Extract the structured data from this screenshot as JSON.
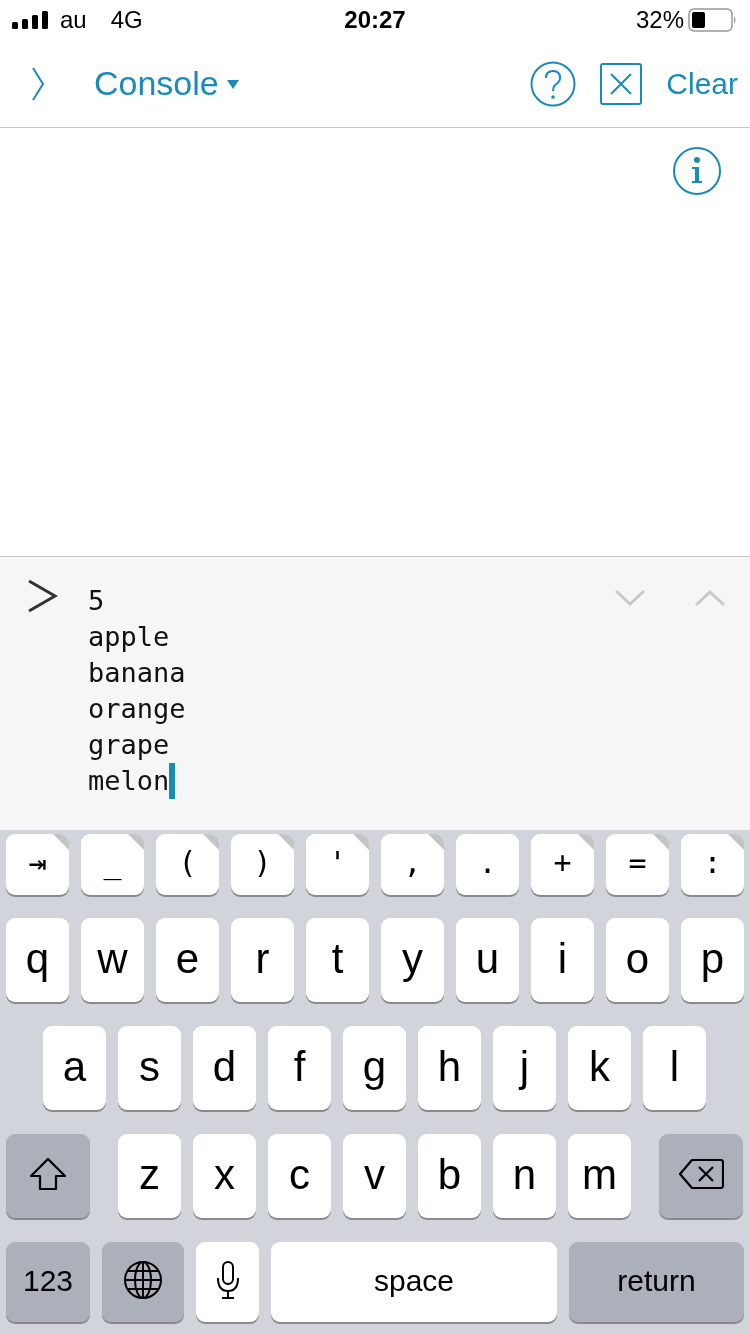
{
  "status_bar": {
    "carrier": "au",
    "network": "4G",
    "time": "20:27",
    "battery": "32%"
  },
  "toolbar": {
    "title": "Console",
    "clear_label": "Clear"
  },
  "console": {
    "input": "5\napple\nbanana\norange\ngrape\nmelon"
  },
  "keyboard": {
    "rows": [
      {
        "kind": "extra",
        "keys": [
          {
            "kind": "char",
            "label": "⇥",
            "corner": true
          },
          {
            "kind": "char",
            "label": "_",
            "corner": true
          },
          {
            "kind": "char",
            "label": "(",
            "corner": true
          },
          {
            "kind": "char",
            "label": ")",
            "corner": true
          },
          {
            "kind": "char",
            "label": "'",
            "corner": true
          },
          {
            "kind": "char",
            "label": ",",
            "corner": true
          },
          {
            "kind": "char",
            "label": ".",
            "corner": false
          },
          {
            "kind": "char",
            "label": "+",
            "corner": true
          },
          {
            "kind": "char",
            "label": "=",
            "corner": true
          },
          {
            "kind": "char",
            "label": ":",
            "corner": true
          }
        ]
      },
      {
        "kind": "letters",
        "keys": [
          {
            "kind": "char",
            "label": "q"
          },
          {
            "kind": "char",
            "label": "w"
          },
          {
            "kind": "char",
            "label": "e"
          },
          {
            "kind": "char",
            "label": "r"
          },
          {
            "kind": "char",
            "label": "t"
          },
          {
            "kind": "char",
            "label": "y"
          },
          {
            "kind": "char",
            "label": "u"
          },
          {
            "kind": "char",
            "label": "i"
          },
          {
            "kind": "char",
            "label": "o"
          },
          {
            "kind": "char",
            "label": "p"
          }
        ]
      },
      {
        "kind": "letters",
        "keys": [
          {
            "kind": "char",
            "label": "a"
          },
          {
            "kind": "char",
            "label": "s"
          },
          {
            "kind": "char",
            "label": "d"
          },
          {
            "kind": "char",
            "label": "f"
          },
          {
            "kind": "char",
            "label": "g"
          },
          {
            "kind": "char",
            "label": "h"
          },
          {
            "kind": "char",
            "label": "j"
          },
          {
            "kind": "char",
            "label": "k"
          },
          {
            "kind": "char",
            "label": "l"
          }
        ]
      },
      {
        "kind": "letters",
        "keys": [
          {
            "kind": "shift"
          },
          {
            "kind": "char",
            "label": "z"
          },
          {
            "kind": "char",
            "label": "x"
          },
          {
            "kind": "char",
            "label": "c"
          },
          {
            "kind": "char",
            "label": "v"
          },
          {
            "kind": "char",
            "label": "b"
          },
          {
            "kind": "char",
            "label": "n"
          },
          {
            "kind": "char",
            "label": "m"
          },
          {
            "kind": "backspace"
          }
        ]
      },
      {
        "kind": "bottom",
        "keys": [
          {
            "kind": "function",
            "label": "123"
          },
          {
            "kind": "globe"
          },
          {
            "kind": "mic"
          },
          {
            "kind": "space",
            "label": "space"
          },
          {
            "kind": "function",
            "label": "return"
          }
        ]
      }
    ]
  }
}
